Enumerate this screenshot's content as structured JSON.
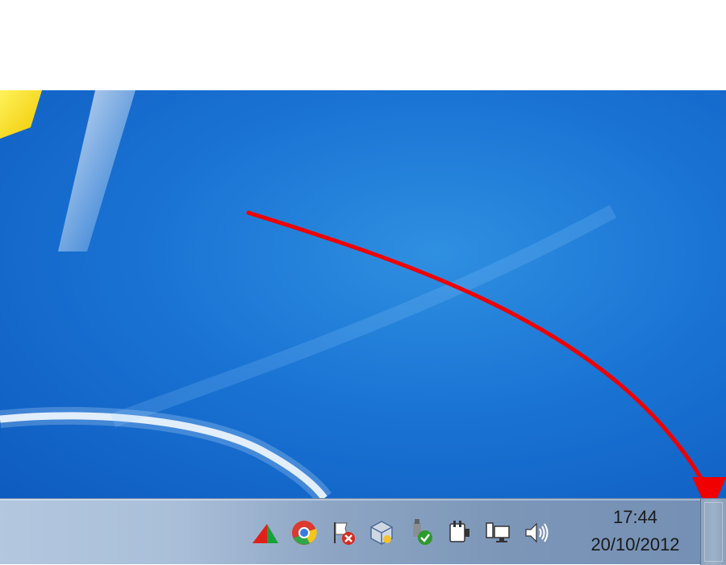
{
  "desktop": {
    "wallpaper": "windows-7-blue",
    "logo_color": "#f3e100"
  },
  "annotation": {
    "color": "#f00000",
    "arrow": "red-curved-arrow-to-show-desktop"
  },
  "taskbar": {
    "tray_icons": [
      {
        "name": "flag-triangle-icon"
      },
      {
        "name": "chrome-icon"
      },
      {
        "name": "action-center-flag-icon"
      },
      {
        "name": "virtualbox-icon"
      },
      {
        "name": "safely-remove-hardware-icon"
      },
      {
        "name": "power-plug-icon"
      },
      {
        "name": "network-icon"
      },
      {
        "name": "volume-icon"
      }
    ],
    "clock": {
      "time": "17:44",
      "date": "20/10/2012"
    }
  }
}
